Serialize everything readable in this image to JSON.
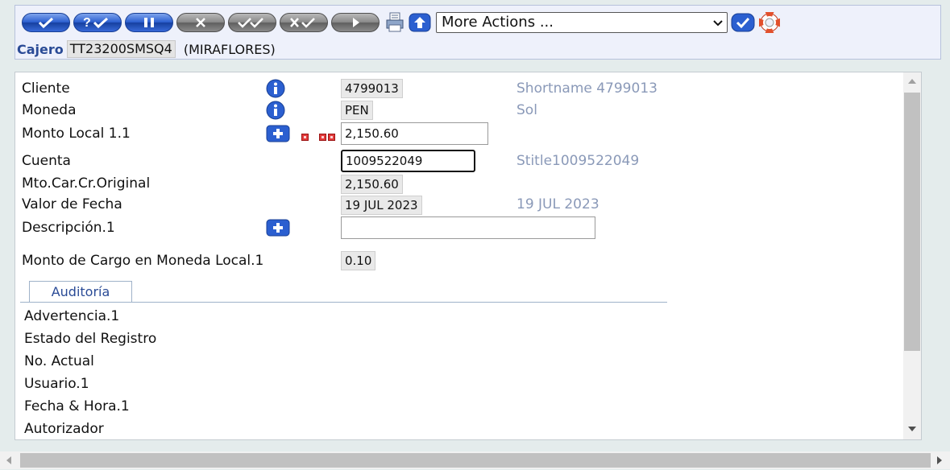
{
  "toolbar": {
    "buttons": [
      {
        "name": "validate",
        "style": "blue",
        "glyph": "check"
      },
      {
        "name": "verify-query",
        "style": "blue",
        "glyph": "question-check"
      },
      {
        "name": "hold",
        "style": "blue",
        "glyph": "pause"
      },
      {
        "name": "delete",
        "style": "grey",
        "glyph": "x"
      },
      {
        "name": "authorise",
        "style": "grey",
        "glyph": "double-check"
      },
      {
        "name": "reverse",
        "style": "grey",
        "glyph": "x-check"
      },
      {
        "name": "next",
        "style": "grey",
        "glyph": "play"
      }
    ],
    "print_icon": "printer-icon",
    "upload_icon": "up-arrow-icon",
    "more_actions": "More Actions ...",
    "go_icon": "check-icon",
    "help_icon": "lifebuoy-icon"
  },
  "cajero": {
    "label": "Cajero",
    "value": "TT23200SMSQ4",
    "branch": "(MIRAFLORES)"
  },
  "form": {
    "cliente": {
      "label": "Cliente",
      "value": "4799013",
      "enrichment": "Shortname 4799013"
    },
    "moneda": {
      "label": "Moneda",
      "value": "PEN",
      "enrichment": "Sol"
    },
    "monto_local": {
      "label": "Monto Local 1.1",
      "value": "2,150.60"
    },
    "cuenta": {
      "label": "Cuenta",
      "value": "1009522049",
      "enrichment": "Stitle1009522049"
    },
    "mto_car": {
      "label": "Mto.Car.Cr.Original",
      "value": "2,150.60"
    },
    "valor_fecha": {
      "label": "Valor de Fecha",
      "value": "19 JUL 2023",
      "enrichment": "19 JUL 2023"
    },
    "descripcion": {
      "label": "Descripción.1",
      "value": ""
    },
    "monto_cargo": {
      "label": "Monto de Cargo en Moneda Local.1",
      "value": "0.10"
    }
  },
  "audit": {
    "tab_label": "Auditoría",
    "fields": [
      "Advertencia.1",
      "Estado del Registro",
      "No. Actual",
      "Usuario.1",
      "Fecha & Hora.1",
      "Autorizador"
    ]
  },
  "colors": {
    "accent_blue": "#2a4b96",
    "enrichment": "#8a99b8",
    "button_blue": "#2b5fd0",
    "button_grey": "#8a8a8a"
  }
}
